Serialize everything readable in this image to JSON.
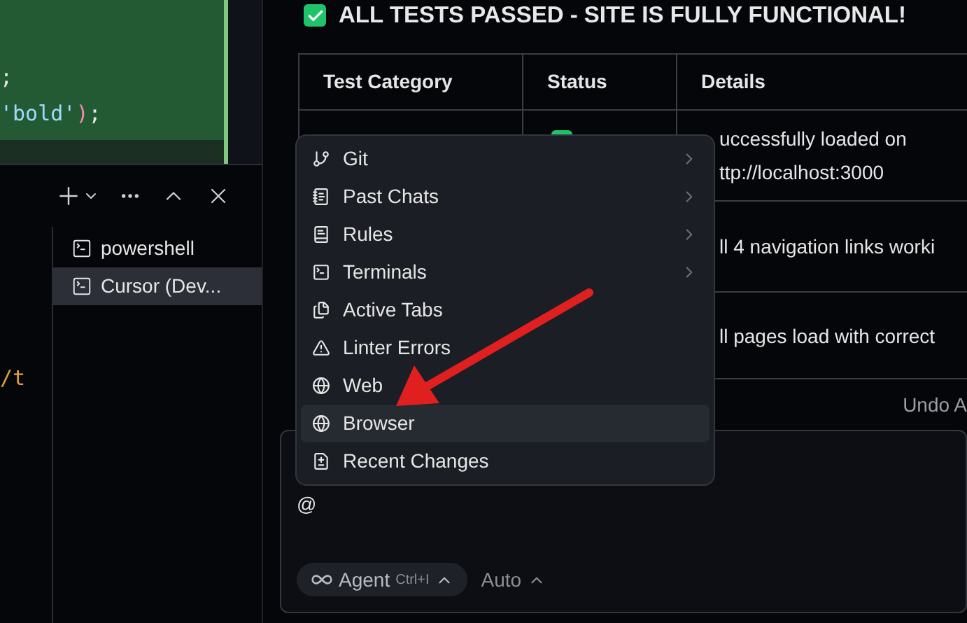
{
  "editor": {
    "lines": [
      [
        {
          "kind": "punct",
          "text": ";"
        }
      ],
      [
        {
          "kind": "string",
          "text": "'bold'"
        },
        {
          "kind": "bracket",
          "text": ")"
        },
        {
          "kind": "punct",
          "text": ";"
        }
      ]
    ]
  },
  "terminal": {
    "tabs": [
      {
        "label": "powershell",
        "selected": false
      },
      {
        "label": "Cursor (Dev...",
        "selected": true
      }
    ],
    "output": "/t"
  },
  "chat": {
    "heading": "ALL TESTS PASSED - SITE IS FULLY FUNCTIONAL!",
    "table": {
      "columns": [
        "Test Category",
        "Status",
        "Details"
      ],
      "rows": [
        {
          "passed": true,
          "details": [
            "uccessfully loaded on",
            "ttp://localhost:3000"
          ]
        },
        {
          "details": [
            "ll 4 navigation links worki"
          ]
        },
        {
          "details": [
            "ll pages load with correct"
          ]
        }
      ]
    },
    "undo": "Undo A",
    "menu": [
      {
        "kind": "git",
        "label": "Git",
        "submenu": true,
        "selected": false
      },
      {
        "kind": "chats",
        "label": "Past Chats",
        "submenu": true,
        "selected": false
      },
      {
        "kind": "rules",
        "label": "Rules",
        "submenu": true,
        "selected": false
      },
      {
        "kind": "terminal",
        "label": "Terminals",
        "submenu": true,
        "selected": false
      },
      {
        "kind": "tabs",
        "label": "Active Tabs",
        "submenu": false,
        "selected": false
      },
      {
        "kind": "warning",
        "label": "Linter Errors",
        "submenu": false,
        "selected": false
      },
      {
        "kind": "globe",
        "label": "Web",
        "submenu": false,
        "selected": false
      },
      {
        "kind": "globe",
        "label": "Browser",
        "submenu": false,
        "selected": true
      },
      {
        "kind": "diff",
        "label": "Recent Changes",
        "submenu": false,
        "selected": false
      }
    ],
    "input": {
      "value": "@"
    },
    "mode": {
      "label": "Agent",
      "shortcut": "Ctrl+I"
    },
    "model": "Auto"
  }
}
